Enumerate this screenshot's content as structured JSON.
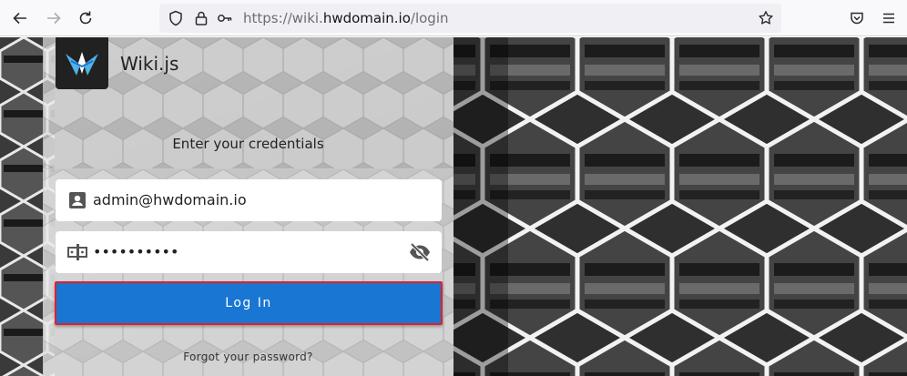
{
  "browser": {
    "url_prefix": "https://wiki.",
    "url_domain": "hwdomain.io",
    "url_path": "/login",
    "icons": [
      "back-arrow-icon",
      "forward-arrow-icon",
      "reload-icon",
      "shield-icon",
      "lock-icon",
      "key-icon",
      "star-icon",
      "pocket-icon",
      "menu-icon"
    ]
  },
  "login": {
    "brand": "Wiki.js",
    "subtitle": "Enter your credentials",
    "email_value": "admin@hwdomain.io",
    "password_value": "••••••••••",
    "login_label": "Log In",
    "forgot_label": "Forgot your password?"
  },
  "colors": {
    "primary": "#1976d2",
    "highlight_border": "#e0202a"
  }
}
